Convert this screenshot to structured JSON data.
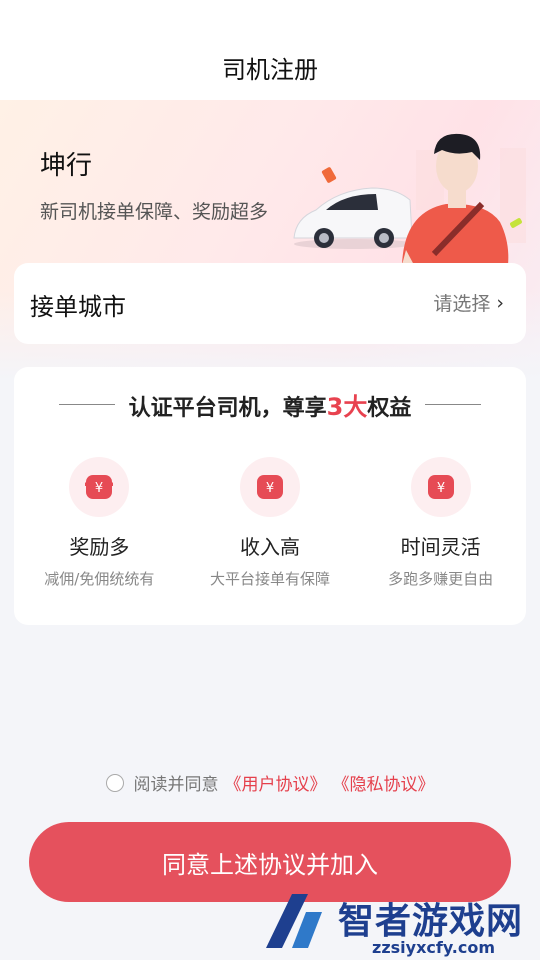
{
  "header": {
    "title": "司机注册"
  },
  "hero": {
    "brand": "坤行",
    "slogan": "新司机接单保障、奖励超多"
  },
  "city": {
    "label": "接单城市",
    "placeholder": "请选择"
  },
  "benefits": {
    "heading_prefix": "认证平台司机，尊享",
    "heading_highlight": "3大",
    "heading_suffix": "权益",
    "items": [
      {
        "name": "奖励多",
        "desc": "减佣/免佣统统有",
        "icon": "yuan-icon"
      },
      {
        "name": "收入高",
        "desc": "大平台接单有保障",
        "icon": "yuan-icon"
      },
      {
        "name": "时间灵活",
        "desc": "多跑多赚更自由",
        "icon": "yuan-icon"
      }
    ]
  },
  "agreement": {
    "prefix": "阅读并同意",
    "user_link": "《用户协议》",
    "privacy_link": "《隐私协议》"
  },
  "join_button": "同意上述协议并加入",
  "watermark": {
    "name": "智者游戏网",
    "url": "zzsiyxcfy.com"
  },
  "colors": {
    "accent": "#e5515d",
    "link": "#e5404c",
    "icon_bg": "#fdeef0"
  }
}
